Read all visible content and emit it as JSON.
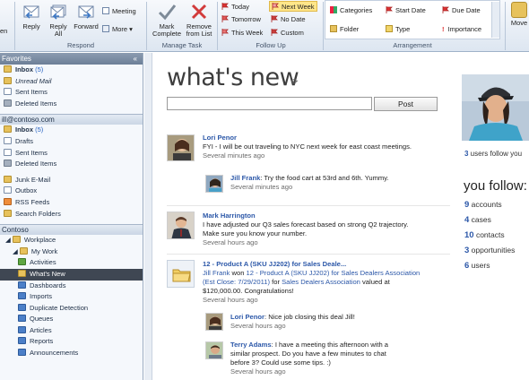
{
  "ribbon": {
    "partial_left_label": "en",
    "respond": {
      "group_label": "Respond",
      "reply": "Reply",
      "reply_all_line1": "Reply",
      "reply_all_line2": "All",
      "forward": "Forward",
      "meeting": "Meeting",
      "more": "More"
    },
    "manage_task": {
      "group_label": "Manage Task",
      "mark_complete_line1": "Mark",
      "mark_complete_line2": "Complete",
      "remove_line1": "Remove",
      "remove_line2": "from List"
    },
    "follow_up": {
      "group_label": "Follow Up",
      "today": "Today",
      "tomorrow": "Tomorrow",
      "this_week": "This Week",
      "next_week": "Next Week",
      "no_date": "No Date",
      "custom": "Custom"
    },
    "arrangement": {
      "group_label": "Arrangement",
      "categories": "Categories",
      "start_date": "Start Date",
      "due_date": "Due Date",
      "folder": "Folder",
      "type": "Type",
      "importance": "Importance"
    },
    "move": {
      "label": "Move"
    }
  },
  "nav": {
    "favorites_header": "Favorites",
    "collapse_glyph": "«",
    "favorites": [
      {
        "label": "Inbox",
        "count": "(5)",
        "bold": true
      },
      {
        "label": "Unread Mail",
        "italic": true
      },
      {
        "label": "Sent Items"
      },
      {
        "label": "Deleted Items"
      }
    ],
    "account_header": "ill@contoso.com",
    "account": [
      {
        "label": "Inbox",
        "count": "(5)",
        "bold": true
      },
      {
        "label": "Drafts"
      },
      {
        "label": "Sent Items"
      },
      {
        "label": "Deleted Items"
      },
      {
        "label": "Junk E-Mail"
      },
      {
        "label": "Outbox"
      },
      {
        "label": "RSS Feeds"
      },
      {
        "label": "Search Folders"
      }
    ],
    "org_header": "Contoso",
    "org": [
      {
        "label": "Workplace"
      },
      {
        "label": "My Work"
      },
      {
        "label": "Activities"
      },
      {
        "label": "What's New",
        "selected": true
      },
      {
        "label": "Dashboards"
      },
      {
        "label": "Imports"
      },
      {
        "label": "Duplicate Detection"
      },
      {
        "label": "Queues"
      },
      {
        "label": "Articles"
      },
      {
        "label": "Reports"
      },
      {
        "label": "Announcements"
      }
    ]
  },
  "main": {
    "title": "what's new",
    "refresh_glyph": "⟳",
    "post_button": "Post",
    "post_input_value": "",
    "posts": [
      {
        "author": "Lori Penor",
        "text": "FYI - I will be out traveling to NYC next week for east coast meetings.",
        "time": "Several minutes ago"
      },
      {
        "author": "Jill Frank",
        "text": ": Try the food cart at 53rd and 6th. Yummy.",
        "time": "Several minutes ago"
      },
      {
        "author": "Mark Harrington",
        "text_line1": "I have adjusted our Q3 sales forecast based on strong Q2 trajectory.",
        "text_line2": "Make sure you know your number.",
        "time": "Several hours ago"
      },
      {
        "title": "12 - Product A (SKU JJ202) for Sales Deale...",
        "actor": "Jill Frank",
        "won_text": " won ",
        "opp_link_line1": "12 - Product A (SKU JJ202) for Sales Dealers Association",
        "opp_link_line2": "(Est Close: 7/29/2011)",
        "for_text": " for ",
        "account_link": "Sales Dealers Association",
        "valued_text": " valued at",
        "value_line": "$120,000.00. Congratulations!",
        "time": "Several hours ago"
      },
      {
        "author": "Lori Penor",
        "text": ": Nice job closing this deal Jill!",
        "time": "Several hours ago"
      },
      {
        "author": "Terry Adams",
        "text_line1": ": I have a meeting this afternoon with a",
        "text_line2": "similar prospect. Do you have a few minutes to chat",
        "text_line3": "before 3? Could use some tips. :)",
        "time": "Several hours ago"
      }
    ],
    "followers": {
      "count": "3",
      "label": " users follow you"
    },
    "you_follow_title": "you follow:",
    "follow_counts": [
      {
        "count": "9",
        "label": " accounts"
      },
      {
        "count": "4",
        "label": " cases"
      },
      {
        "count": "10",
        "label": " contacts"
      },
      {
        "count": "3",
        "label": " opportunities"
      },
      {
        "count": "6",
        "label": " users"
      }
    ]
  }
}
